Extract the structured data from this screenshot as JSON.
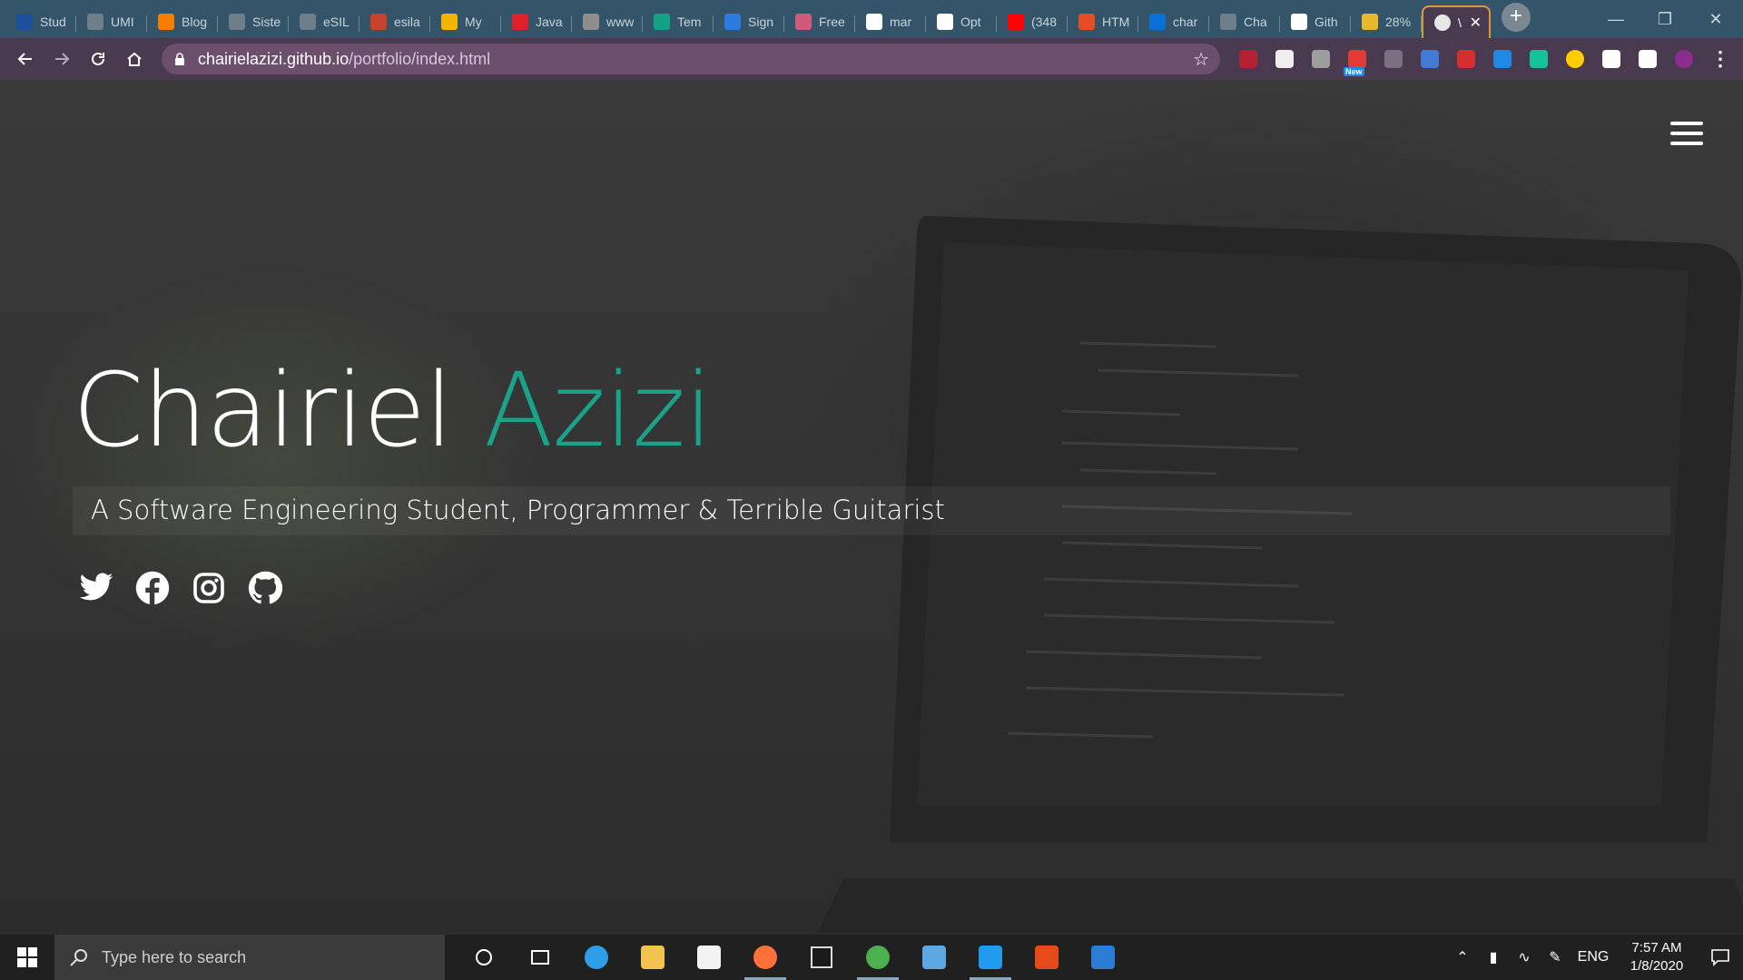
{
  "browser": {
    "tabs": [
      {
        "title": "Stud",
        "icon": "unsri-icon",
        "color": "#1c4f9c"
      },
      {
        "title": "UMI",
        "icon": "globe-icon",
        "color": "#6e7f8a"
      },
      {
        "title": "Blog",
        "icon": "blogger-icon",
        "color": "#f57d00"
      },
      {
        "title": "Siste",
        "icon": "globe-icon",
        "color": "#6e7f8a"
      },
      {
        "title": "eSIL",
        "icon": "globe-icon",
        "color": "#6e7f8a"
      },
      {
        "title": "esila",
        "icon": "warning-icon",
        "color": "#c8422d"
      },
      {
        "title": "My",
        "icon": "drive-icon",
        "color": "#f4b400"
      },
      {
        "title": "Java",
        "icon": "tryhackme-icon",
        "color": "#e01f2d"
      },
      {
        "title": "www",
        "icon": "feather-icon",
        "color": "#8e8e8e"
      },
      {
        "title": "Tem",
        "icon": "ss-icon",
        "color": "#16a085"
      },
      {
        "title": "Sign",
        "icon": "flag-icon",
        "color": "#2d7be0"
      },
      {
        "title": "Free",
        "icon": "shapes-icon",
        "color": "#d0597c"
      },
      {
        "title": "mar",
        "icon": "github-icon",
        "color": "#ffffff"
      },
      {
        "title": "Opt",
        "icon": "github-icon",
        "color": "#ffffff"
      },
      {
        "title": "(348",
        "icon": "youtube-icon",
        "color": "#ff0000"
      },
      {
        "title": "HTM",
        "icon": "html-icon",
        "color": "#e44d26"
      },
      {
        "title": "char",
        "icon": "azure-icon",
        "color": "#0a6fd6"
      },
      {
        "title": "Cha",
        "icon": "globe-icon",
        "color": "#6e7f8a"
      },
      {
        "title": "Gith",
        "icon": "github-icon",
        "color": "#ffffff"
      },
      {
        "title": "28%",
        "icon": "progress-icon",
        "color": "#e7b82b"
      }
    ],
    "active_tab": {
      "title": "\\",
      "icon": "globe-icon"
    },
    "new_tab_label": "+",
    "url_host": "chairielazizi.github.io",
    "url_path": "/portfolio/index.html",
    "extensions": [
      {
        "name": "flag-us-icon",
        "color": "#b22234"
      },
      {
        "name": "glasses-icon",
        "color": "#eeeeee"
      },
      {
        "name": "cup-icon",
        "color": "#9e9e9e"
      },
      {
        "name": "new-badge-icon",
        "color": "#e53935",
        "badge": "New"
      },
      {
        "name": "gear-ext-icon",
        "color": "#7d6f80"
      },
      {
        "name": "pen-icon",
        "color": "#3f7bd6"
      },
      {
        "name": "pdf-icon",
        "color": "#d32f2f"
      },
      {
        "name": "s-icon",
        "color": "#1e88e5"
      },
      {
        "name": "grammarly-icon",
        "color": "#15c39a"
      },
      {
        "name": "pacman-icon",
        "color": "#ffcc00"
      },
      {
        "name": "puzzle-icon",
        "color": "#ffffff"
      },
      {
        "name": "playlist-icon",
        "color": "#ffffff"
      },
      {
        "name": "avatar-icon",
        "color": "#8b2d8f"
      },
      {
        "name": "menu-dots-icon",
        "color": "#ffffff"
      }
    ]
  },
  "page": {
    "first_name": "Chairiel",
    "last_name": "Azizi",
    "tagline": "A Software Engineering Student, Programmer & Terrible Guitarist",
    "accent_color": "#1aa389",
    "socials": [
      "twitter-icon",
      "facebook-icon",
      "instagram-icon",
      "github-icon"
    ]
  },
  "taskbar": {
    "search_placeholder": "Type here to search",
    "apps": [
      "cortana-icon",
      "task-view-icon",
      "edge-icon",
      "file-explorer-icon",
      "store-icon",
      "firefox-icon",
      "notion-icon",
      "chrome-icon",
      "mail-icon",
      "vscode-icon",
      "office-icon",
      "word-icon"
    ],
    "running": [
      "firefox-icon",
      "chrome-icon",
      "vscode-icon"
    ],
    "language": "ENG",
    "time": "7:57 AM",
    "date": "1/8/2020"
  }
}
